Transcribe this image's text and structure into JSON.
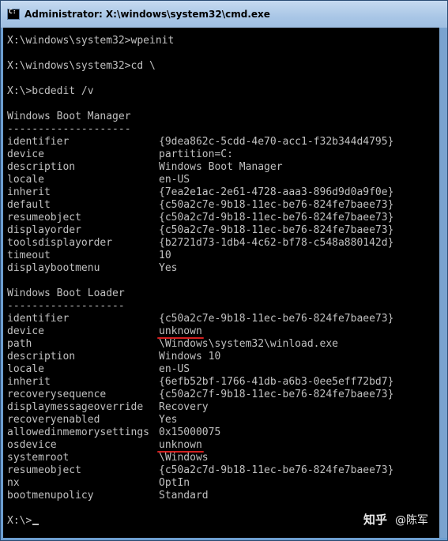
{
  "window": {
    "title": "Administrator: X:\\windows\\system32\\cmd.exe"
  },
  "console": {
    "commands": {
      "wpeinit": "X:\\windows\\system32>wpeinit",
      "cd": "X:\\windows\\system32>cd \\",
      "bcdedit": "X:\\>bcdedit /v",
      "prompt": "X:\\>"
    },
    "boot_manager": {
      "heading": "Windows Boot Manager",
      "rule": "--------------------",
      "entries": [
        {
          "key": "identifier",
          "value": "{9dea862c-5cdd-4e70-acc1-f32b344d4795}"
        },
        {
          "key": "device",
          "value": "partition=C:"
        },
        {
          "key": "description",
          "value": "Windows Boot Manager"
        },
        {
          "key": "locale",
          "value": "en-US"
        },
        {
          "key": "inherit",
          "value": "{7ea2e1ac-2e61-4728-aaa3-896d9d0a9f0e}"
        },
        {
          "key": "default",
          "value": "{c50a2c7e-9b18-11ec-be76-824fe7baee73}"
        },
        {
          "key": "resumeobject",
          "value": "{c50a2c7d-9b18-11ec-be76-824fe7baee73}"
        },
        {
          "key": "displayorder",
          "value": "{c50a2c7e-9b18-11ec-be76-824fe7baee73}"
        },
        {
          "key": "toolsdisplayorder",
          "value": "{b2721d73-1db4-4c62-bf78-c548a880142d}"
        },
        {
          "key": "timeout",
          "value": "10"
        },
        {
          "key": "displaybootmenu",
          "value": "Yes"
        }
      ]
    },
    "boot_loader": {
      "heading": "Windows Boot Loader",
      "rule": "-------------------",
      "entries": [
        {
          "key": "identifier",
          "value": "{c50a2c7e-9b18-11ec-be76-824fe7baee73}"
        },
        {
          "key": "device",
          "value": "unknown"
        },
        {
          "key": "path",
          "value": "\\Windows\\system32\\winload.exe"
        },
        {
          "key": "description",
          "value": "Windows 10"
        },
        {
          "key": "locale",
          "value": "en-US"
        },
        {
          "key": "inherit",
          "value": "{6efb52bf-1766-41db-a6b3-0ee5eff72bd7}"
        },
        {
          "key": "recoverysequence",
          "value": "{c50a2c7f-9b18-11ec-be76-824fe7baee73}"
        },
        {
          "key": "displaymessageoverride",
          "value": "Recovery"
        },
        {
          "key": "recoveryenabled",
          "value": "Yes"
        },
        {
          "key": "allowedinmemorysettings",
          "value": "0x15000075"
        },
        {
          "key": "osdevice",
          "value": "unknown"
        },
        {
          "key": "systemroot",
          "value": "\\Windows"
        },
        {
          "key": "resumeobject",
          "value": "{c50a2c7d-9b18-11ec-be76-824fe7baee73}"
        },
        {
          "key": "nx",
          "value": "OptIn"
        },
        {
          "key": "bootmenupolicy",
          "value": "Standard"
        }
      ]
    }
  },
  "watermark": {
    "logo": "知乎",
    "author": "@陈军"
  },
  "colors": {
    "console_bg": "#000000",
    "console_text": "#c0c0c0",
    "annotation_underline": "#d22020"
  }
}
